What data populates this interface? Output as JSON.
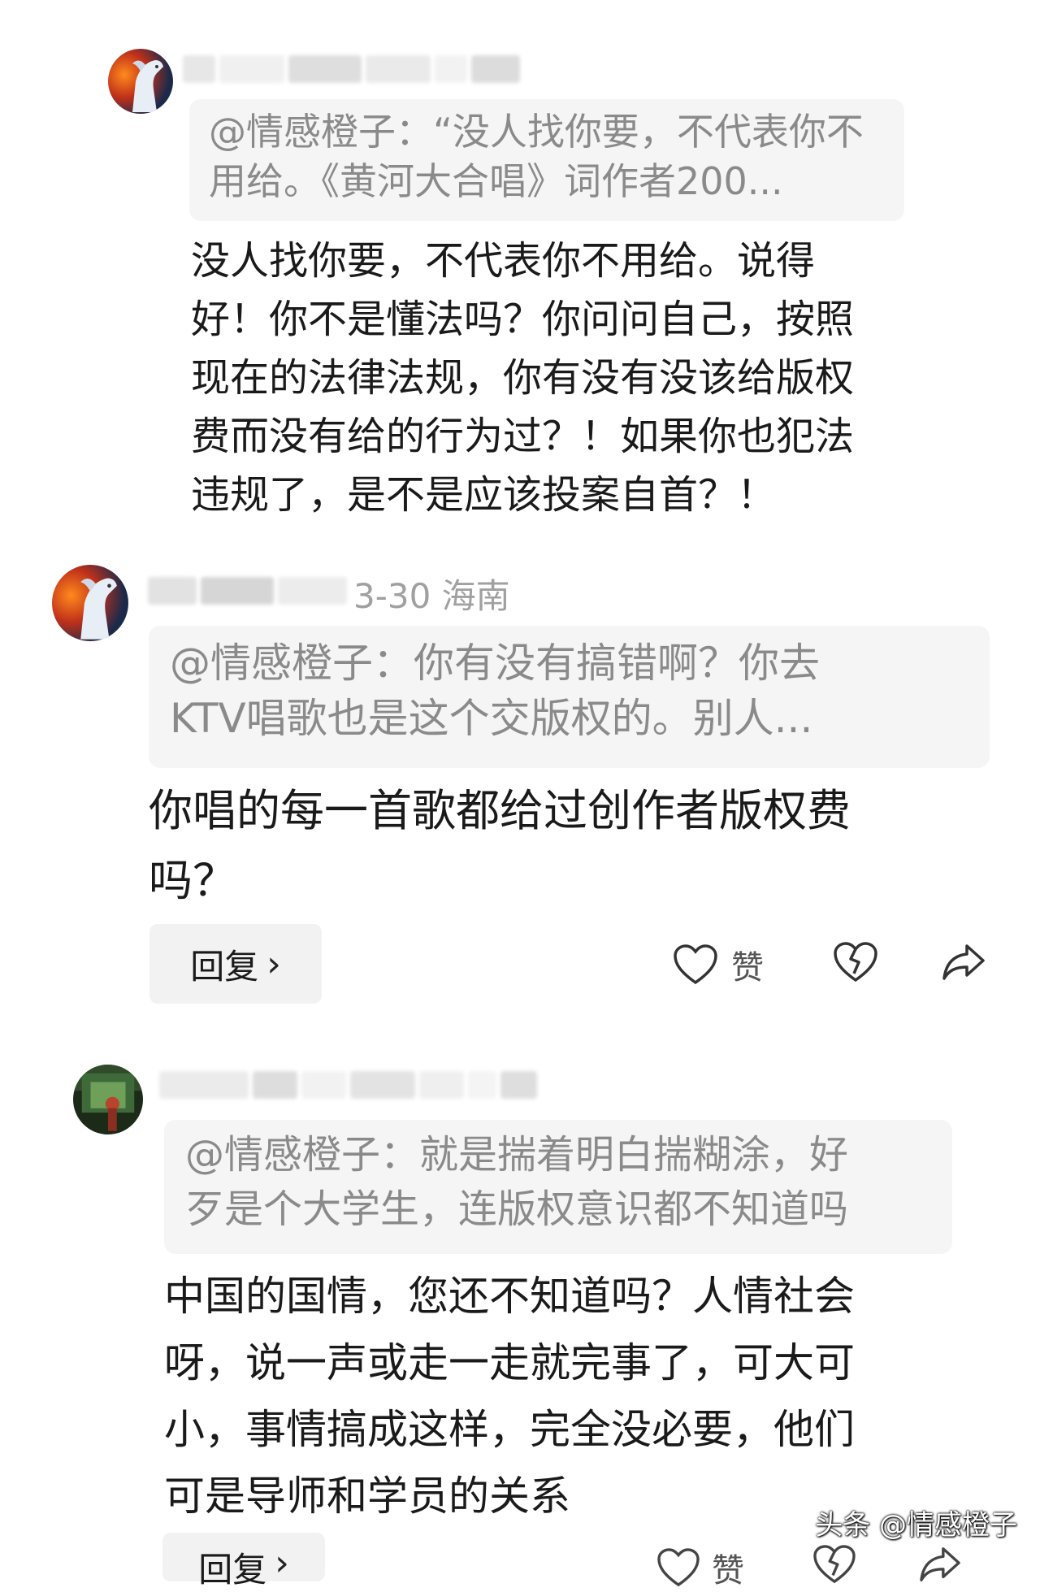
{
  "comments": [
    {
      "quote_lines": [
        "@情感橙子：“没人找你要，不代表你不",
        "用给。《黄河大合唱》词作者200..."
      ],
      "body_lines": [
        "没人找你要，不代表你不用给。说得",
        "好！你不是懂法吗？你问问自己，按照",
        "现在的法律法规，你有没有没该给版权",
        "费而没有给的行为过？！如果你也犯法",
        "违规了，是不是应该投案自首？！"
      ]
    },
    {
      "meta": "3-30  海南",
      "quote_lines": [
        "@情感橙子：你有没有搞错啊？你去",
        "KTV唱歌也是这个交版权的。别人..."
      ],
      "body_lines": [
        "你唱的每一首歌都给过创作者版权费",
        "吗？"
      ],
      "reply_label": "回复",
      "like_label": "赞"
    },
    {
      "quote_lines": [
        "@情感橙子：就是揣着明白揣糊涂，好",
        "歹是个大学生，连版权意识都不知道吗"
      ],
      "body_lines": [
        "中国的国情，您还不知道吗？人情社会",
        "呀，说一声或走一走就完事了，可大可",
        "小，事情搞成这样，完全没必要，他们",
        "可是导师和学员的关系"
      ],
      "reply_label": "回复",
      "like_label": "赞"
    }
  ],
  "watermark": "头条 @情感橙子",
  "icons": [
    "heart-icon",
    "broken-heart-icon",
    "share-icon",
    "chevron-right-icon"
  ],
  "colors": {
    "quote_bg": "#f5f5f5",
    "quote_text": "#8a8a8a",
    "meta_text": "#a0a0a0"
  }
}
